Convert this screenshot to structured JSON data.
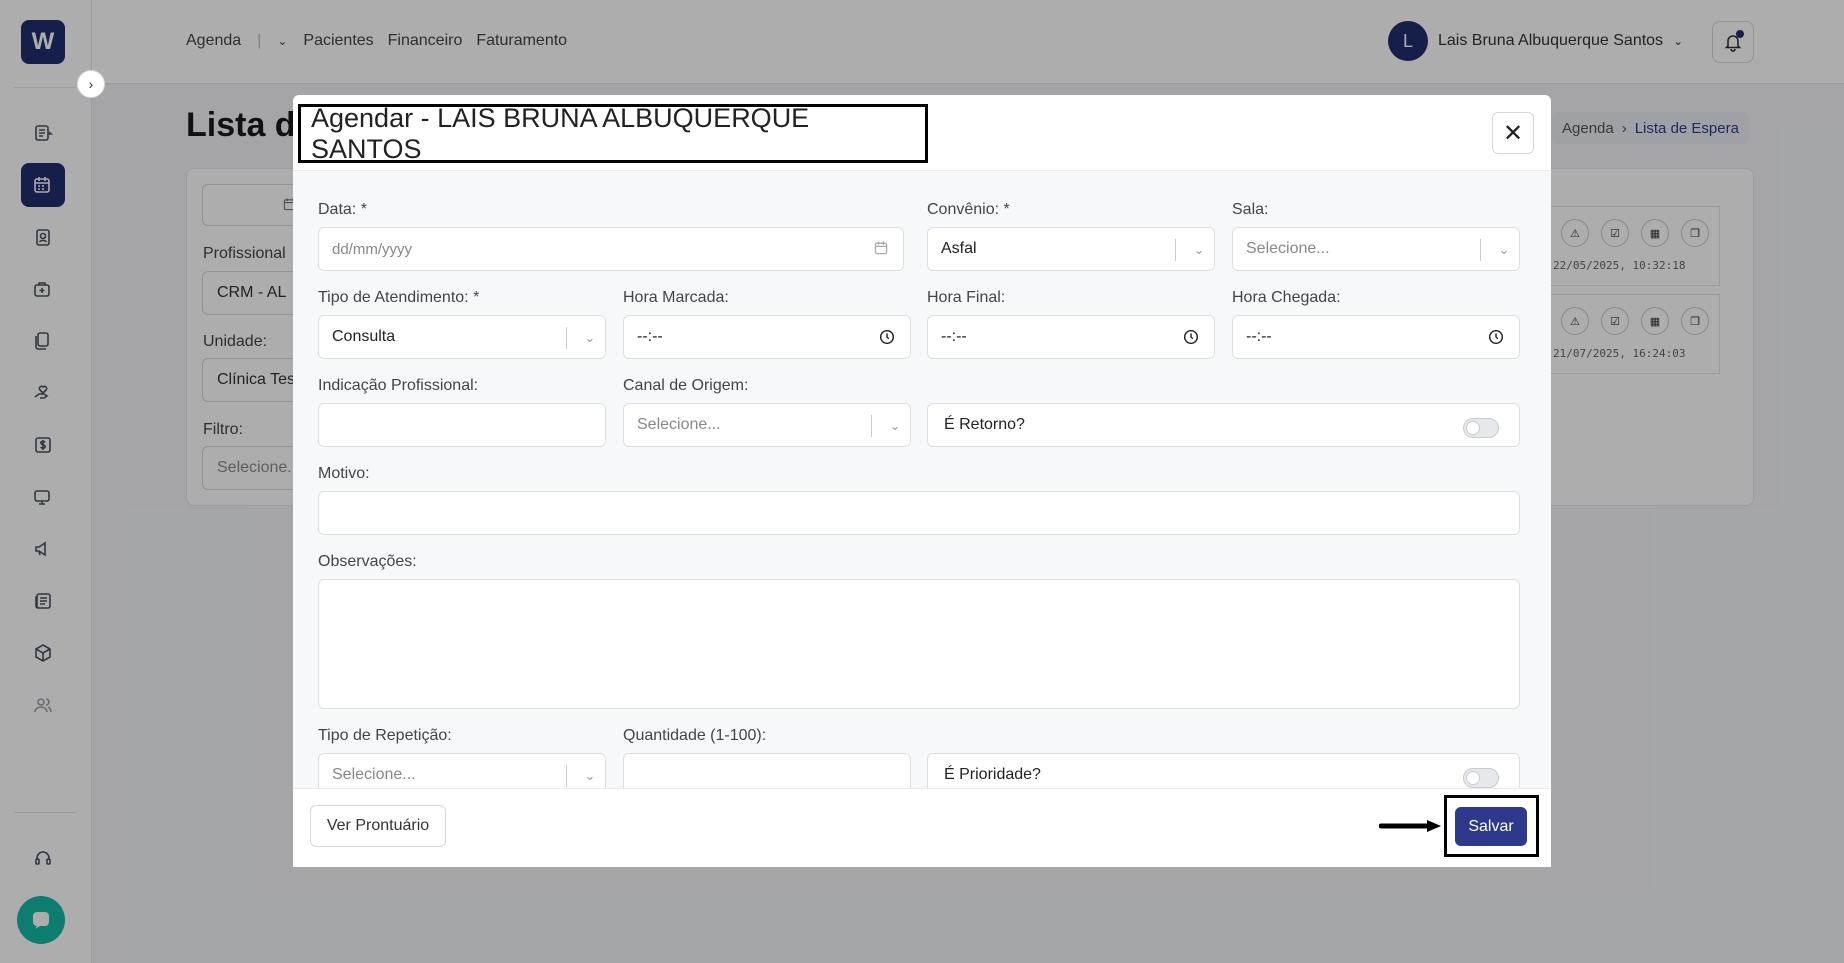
{
  "app": {
    "logo_letter": "W"
  },
  "topbar": {
    "nav": [
      "Agenda",
      "Pacientes",
      "Financeiro",
      "Faturamento"
    ],
    "user_name": "Lais Bruna Albuquerque Santos",
    "user_initial": "L"
  },
  "page": {
    "title": "Lista de Espera",
    "title_visible": "Lista d",
    "breadcrumb": [
      "Agenda",
      "Lista de Espera"
    ],
    "filters": {
      "profissional_label": "Profissional",
      "profissional_value": "CRM - AL",
      "unidade_label": "Unidade:",
      "unidade_value": "Clínica Tes",
      "filtro_label": "Filtro:",
      "filtro_placeholder": "Selecione."
    },
    "rows": [
      {
        "timestamp": "22/05/2025, 10:32:18"
      },
      {
        "timestamp": "21/07/2025, 16:24:03"
      }
    ]
  },
  "modal": {
    "title": "Agendar - LAIS BRUNA ALBUQUERQUE SANTOS",
    "fields": {
      "data_label": "Data: *",
      "data_placeholder": "dd/mm/yyyy",
      "convenio_label": "Convênio: *",
      "convenio_value": "Asfal",
      "sala_label": "Sala:",
      "sala_placeholder": "Selecione...",
      "tipo_label": "Tipo de Atendimento: *",
      "tipo_value": "Consulta",
      "hora_marcada_label": "Hora Marcada:",
      "hora_marcada_value": "--:--",
      "hora_final_label": "Hora Final:",
      "hora_final_value": "--:--",
      "hora_chegada_label": "Hora Chegada:",
      "hora_chegada_value": "--:--",
      "indicacao_label": "Indicação Profissional:",
      "canal_label": "Canal de Origem:",
      "canal_placeholder": "Selecione...",
      "retorno_label": "É Retorno?",
      "motivo_label": "Motivo:",
      "observacoes_label": "Observações:",
      "repeticao_label": "Tipo de Repetição:",
      "repeticao_placeholder": "Selecione...",
      "quantidade_label": "Quantidade (1-100):",
      "prioridade_label": "É Prioridade?"
    },
    "footer": {
      "prontuario_label": "Ver Prontuário",
      "save_label": "Salvar"
    }
  }
}
